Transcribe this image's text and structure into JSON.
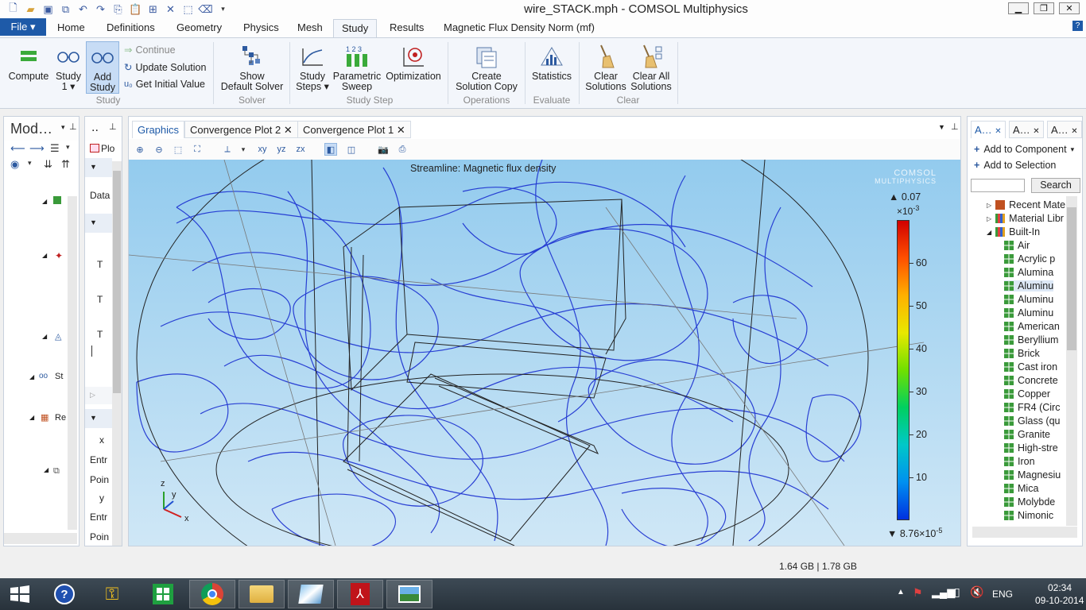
{
  "window": {
    "title": "wire_STACK.mph - COMSOL Multiphysics",
    "min": "▁",
    "restore": "❐",
    "close": "✕"
  },
  "menu": {
    "file": "File ▾",
    "tabs": [
      "Home",
      "Definitions",
      "Geometry",
      "Physics",
      "Mesh",
      "Study",
      "Results",
      "Magnetic Flux Density Norm (mf)"
    ],
    "active_tab": "Study",
    "help": "?"
  },
  "ribbon": {
    "compute": "Compute",
    "study1_a": "Study",
    "study1_b": "1 ▾",
    "add_study_a": "Add",
    "add_study_b": "Study",
    "continue": "Continue",
    "update_solution": "Update Solution",
    "get_initial_value": "Get Initial Value",
    "show_default_solver_a": "Show",
    "show_default_solver_b": "Default Solver",
    "study_steps_a": "Study",
    "study_steps_b": "Steps ▾",
    "parametric_sweep_a": "Parametric",
    "parametric_sweep_b": "Sweep",
    "optimization": "Optimization",
    "create_solution_copy_a": "Create",
    "create_solution_copy_b": "Solution Copy",
    "statistics": "Statistics",
    "clear_solutions_a": "Clear",
    "clear_solutions_b": "Solutions",
    "clear_all_a": "Clear All",
    "clear_all_b": "Solutions",
    "groups": {
      "study": "Study",
      "solver": "Solver",
      "study_step": "Study Step",
      "operations": "Operations",
      "evaluate": "Evaluate",
      "clear": "Clear"
    }
  },
  "model_builder": {
    "title": "Mod…",
    "labels": {
      "st": "St",
      "re": "Re"
    }
  },
  "settings": {
    "title": "..",
    "plot": "Plo",
    "data": "Data",
    "t1": "T",
    "t2": "T",
    "t3": "T",
    "x": "x",
    "entry1": "Entr",
    "point1": "Poin",
    "y": "y",
    "entry2": "Entr",
    "point2": "Poin"
  },
  "graphics": {
    "tabs": [
      "Graphics",
      "Convergence Plot 2",
      "Convergence Plot 1"
    ],
    "plot_title": "Streamline: Magnetic flux density",
    "logo_a": "COMSOL",
    "logo_b": "MULTIPHYSICS",
    "colorbar": {
      "max": "▲ 0.07",
      "exp": "×10",
      "exp_sup": "-3",
      "ticks": [
        "60",
        "50",
        "40",
        "30",
        "20",
        "10"
      ],
      "min": "▼ 8.76×10",
      "min_sup": "-5",
      "colors": [
        "#d00000",
        "#ff5000",
        "#ffb000",
        "#e8e800",
        "#70e000",
        "#00d060",
        "#00c8c8",
        "#0090f0",
        "#0030e0"
      ]
    },
    "axes": {
      "z": "z",
      "y": "y",
      "x": "x"
    }
  },
  "materials": {
    "tabs": [
      "A…",
      "A…",
      "A…"
    ],
    "add_to_component": "Add to Component",
    "add_to_selection": "Add to Selection",
    "search_button": "Search",
    "search_value": "",
    "folders": [
      "Recent Mate",
      "Material Libr",
      "Built-In"
    ],
    "items": [
      "Air",
      "Acrylic p",
      "Alumina",
      "Aluminu",
      "Aluminu",
      "Aluminu",
      "American",
      "Beryllium",
      "Brick",
      "Cast iron",
      "Concrete",
      "Copper",
      "FR4 (Circ",
      "Glass (qu",
      "Granite",
      "High-stre",
      "Iron",
      "Magnesiu",
      "Mica",
      "Molybde",
      "Nimonic"
    ]
  },
  "status": {
    "memory": "1.64 GB | 1.78 GB"
  },
  "taskbar": {
    "lang": "ENG",
    "time": "02:34",
    "date": "09-10-2014"
  }
}
